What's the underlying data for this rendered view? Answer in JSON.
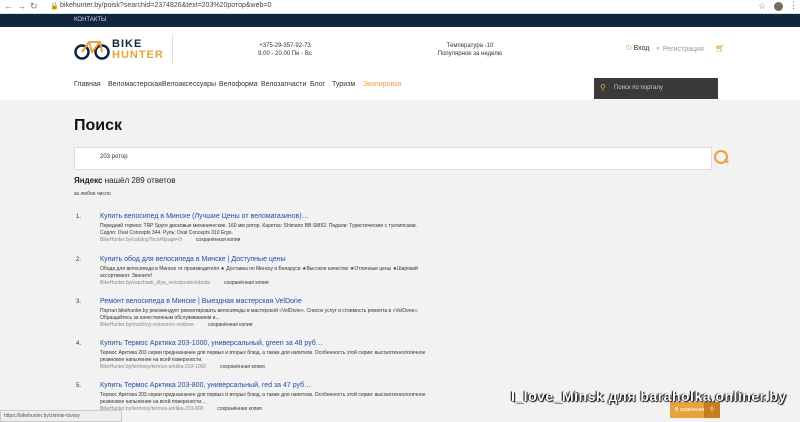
{
  "browser": {
    "url": "bikehunter.by/poisk?searchid=2374826&text=203%20ротор&web=0"
  },
  "topbar": {
    "contacts": "КОНТАКТЫ"
  },
  "logo": {
    "line1": "BIKE",
    "line2": "HUNTER"
  },
  "contact": {
    "phone": "+375-29-357-92-73",
    "hours": "9.00 - 20.00 Пн - Вс"
  },
  "weather": {
    "temp": "Температура -10",
    "popular": "Популярное за неделю"
  },
  "account": {
    "login": "Вход",
    "register": "Регистрация"
  },
  "nav": [
    "Главная",
    "Веломастерская",
    "Велоаксессуары",
    "Велоформа",
    "Велозапчасти",
    "Блог",
    "Туризм",
    "Экипировка"
  ],
  "site_search": {
    "placeholder": "Поиск по порталу"
  },
  "page": {
    "title": "Поиск"
  },
  "query": {
    "value": "203 ротор"
  },
  "results_summary": {
    "brand": "Яндекс",
    "text": "нашёл 289 ответов",
    "anytime": "за любое число"
  },
  "results": [
    {
      "num": "1.",
      "title": "Купить велосипед в Минске (Лучшие Цены от веломагазинов)…",
      "desc": "Передний тормоз: TRP Spyre дисковые механические, 160 мм ротор. Каретка: Shimano BB-SM52. Педали: Туристические с туклипсами. Седло: Oval Concepts 344. Руль: Oval Concepts 310 Ergo.",
      "url": "BikeHunter.by/catalog?bcn#8page=3",
      "cache": "сохранённая копия"
    },
    {
      "num": "2.",
      "title": "Купить обод для велосипеда в Минске | Доступные цены",
      "desc": "Обода для велосипеда в Минске от производителя ★ Доставка по Минску и Беларуси ★Высокое качество ★Отличные цены ★Широкий ассортимент. Звоните!",
      "url": "BikeHunter.by/zapchasti_dlya_velosipedov/oboda",
      "cache": "сохранённая копия"
    },
    {
      "num": "3.",
      "title": "Ремонт велосипеда в Минске | Выездная мастерская VelDone",
      "desc": "Портал bikehunter.by рекомендует ремонтировать велосипеды в мастерской «VelDone». Список услуг и стоимость ремонта в «VelDone». Обращайтесь за качественным обслуживанием и...",
      "url": "BikeHunter.by/mobilnyj-veloservis-veldone",
      "cache": "сохранённая копия"
    },
    {
      "num": "4.",
      "title": "Купить Термос Арктика 203-1000, универсальный, green за 48 руб…",
      "desc": "Термос Арктика 203 серии предназначен для первых и вторых блюд, а также для напитков. Особенность этой серии: высокотехнологичное резиновое напыление на всей поверхности.",
      "url": "BikeHunter.by/termosy/termos-arktika-203-1000",
      "cache": "сохранённая копия"
    },
    {
      "num": "5.",
      "title": "Купить Термос Арктика 203-800, универсальный, red за 47 руб…",
      "desc": "Термос Арктика 203 серии предназначен для первых и вторых блюд, а также для напитков. Особенность этой серии: высокотехнологичное резиновое напыление на всей поверхности...",
      "url": "BikeHunter.by/termosy/termos-arktika-203-800",
      "cache": "сохранённая копия"
    }
  ],
  "statusbar": {
    "link": "https://bikehunter.by/zimnie-tovary"
  },
  "compare": {
    "label": "В сравнении",
    "count": "0"
  },
  "watermark": {
    "text": "I_love_Minsk для baraholka.onliner.by"
  }
}
